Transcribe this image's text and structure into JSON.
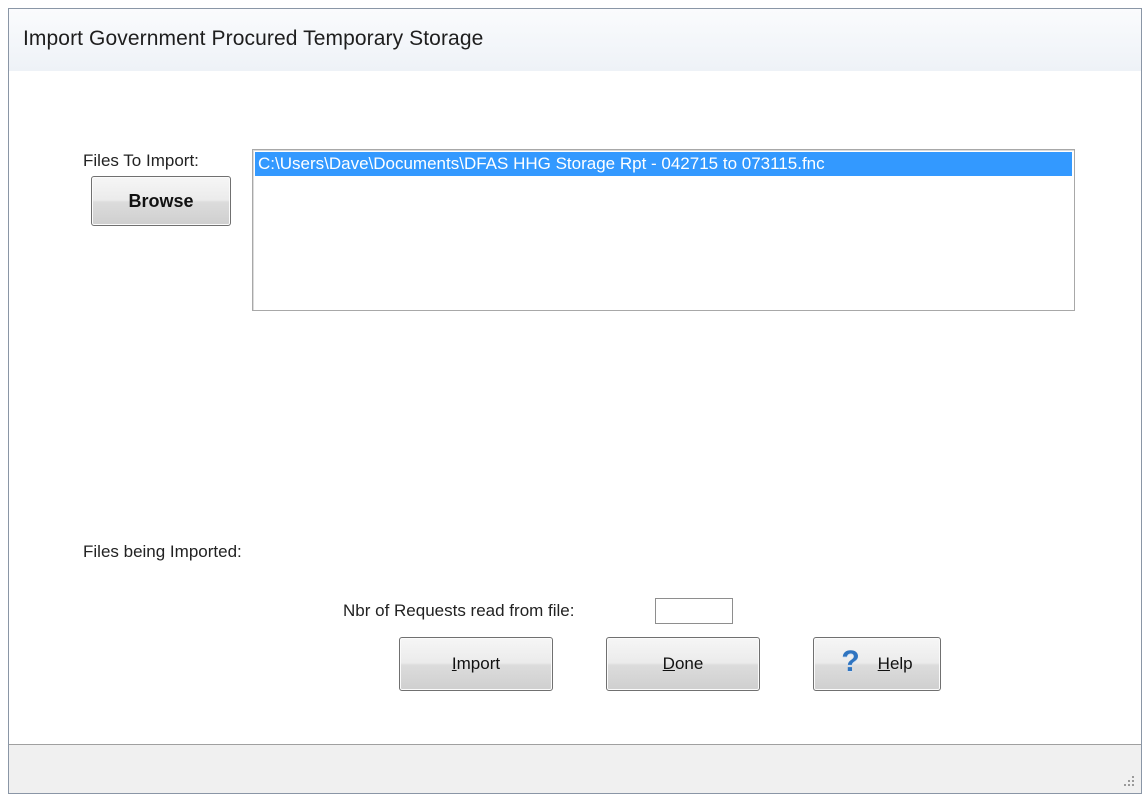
{
  "window": {
    "title": "Import Government Procured Temporary Storage"
  },
  "files": {
    "label": "Files To Import:",
    "browse_label": "Browse",
    "items": [
      "C:\\Users\\Dave\\Documents\\DFAS HHG Storage Rpt - 042715 to 073115.fnc"
    ]
  },
  "progress": {
    "label": "Files being Imported:",
    "count_label": "Nbr of Requests read from file:",
    "count_value": ""
  },
  "buttons": {
    "import": {
      "mnemonic": "I",
      "rest": "mport"
    },
    "done": {
      "mnemonic": "D",
      "rest": "one"
    },
    "help": {
      "mnemonic": "H",
      "rest": "elp",
      "icon": "question-mark-icon"
    }
  },
  "colors": {
    "selection": "#3399ff",
    "help_icon": "#2f74c0"
  }
}
